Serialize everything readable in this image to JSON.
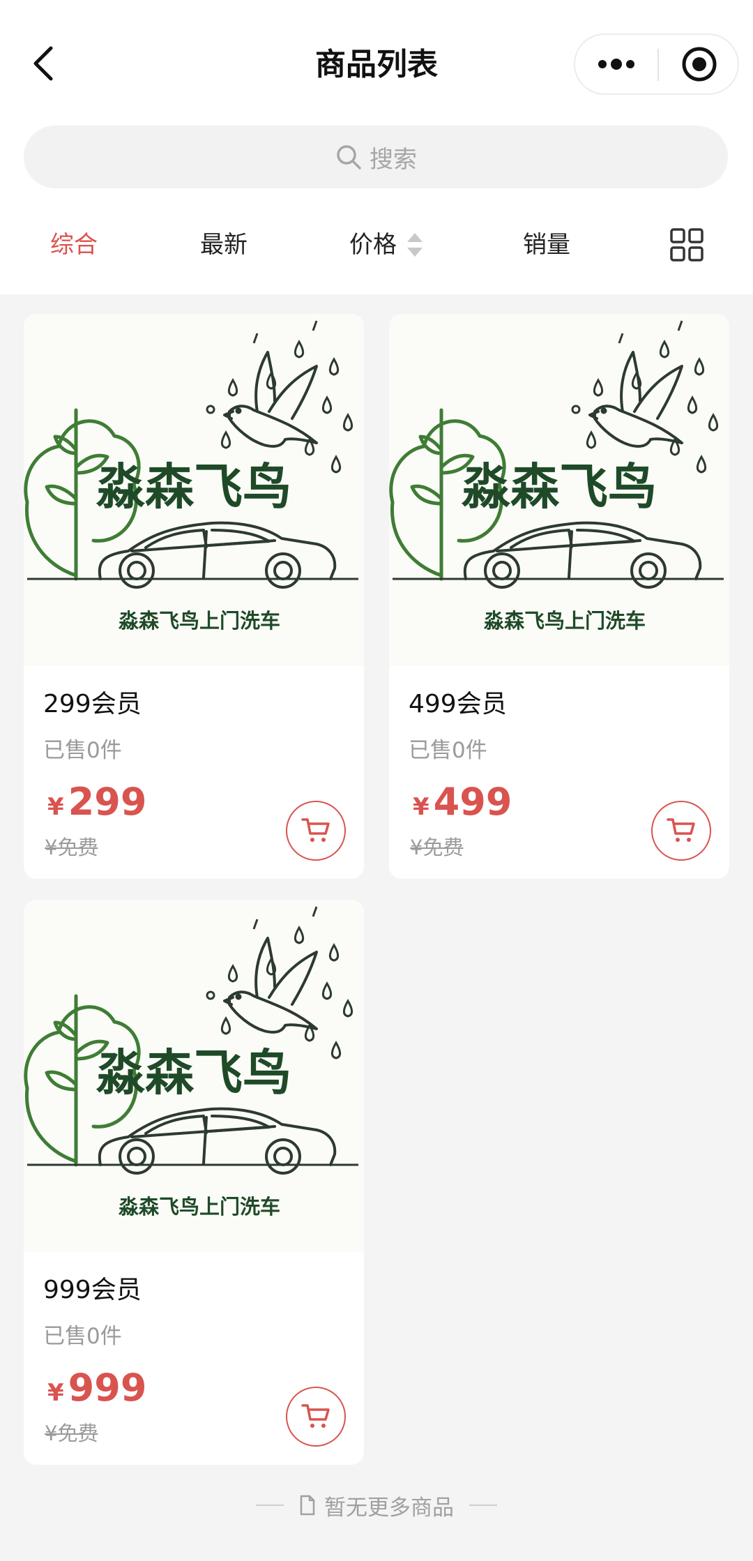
{
  "nav": {
    "title": "商品列表",
    "back_icon": "chevron-left-icon",
    "more_icon": "more-dots-icon",
    "close_icon": "target-circle-icon"
  },
  "search": {
    "placeholder": "搜索",
    "icon": "search-icon"
  },
  "sort_tabs": [
    {
      "label": "综合",
      "active": true
    },
    {
      "label": "最新",
      "active": false
    },
    {
      "label": "价格",
      "active": false
    },
    {
      "label": "销量",
      "active": false
    }
  ],
  "layout_toggle_icon": "grid-view-icon",
  "products": [
    {
      "image": {
        "brand": "淼森飞鸟",
        "caption": "淼森飞鸟上门洗车"
      },
      "name": "299会员",
      "sold": "已售0件",
      "currency": "¥",
      "price": "299",
      "original_price": "¥免费",
      "cart_icon": "cart-icon"
    },
    {
      "image": {
        "brand": "淼森飞鸟",
        "caption": "淼森飞鸟上门洗车"
      },
      "name": "499会员",
      "sold": "已售0件",
      "currency": "¥",
      "price": "499",
      "original_price": "¥免费",
      "cart_icon": "cart-icon"
    },
    {
      "image": {
        "brand": "淼森飞鸟",
        "caption": "淼森飞鸟上门洗车"
      },
      "name": "999会员",
      "sold": "已售0件",
      "currency": "¥",
      "price": "999",
      "original_price": "¥免费",
      "cart_icon": "cart-icon"
    }
  ],
  "footer": {
    "text": "暂无更多商品",
    "icon": "document-icon"
  },
  "colors": {
    "accent": "#d9534f",
    "leaf_green": "#3f7d35",
    "brand_text": "#1f4a28",
    "background": "#f4f4f5"
  }
}
